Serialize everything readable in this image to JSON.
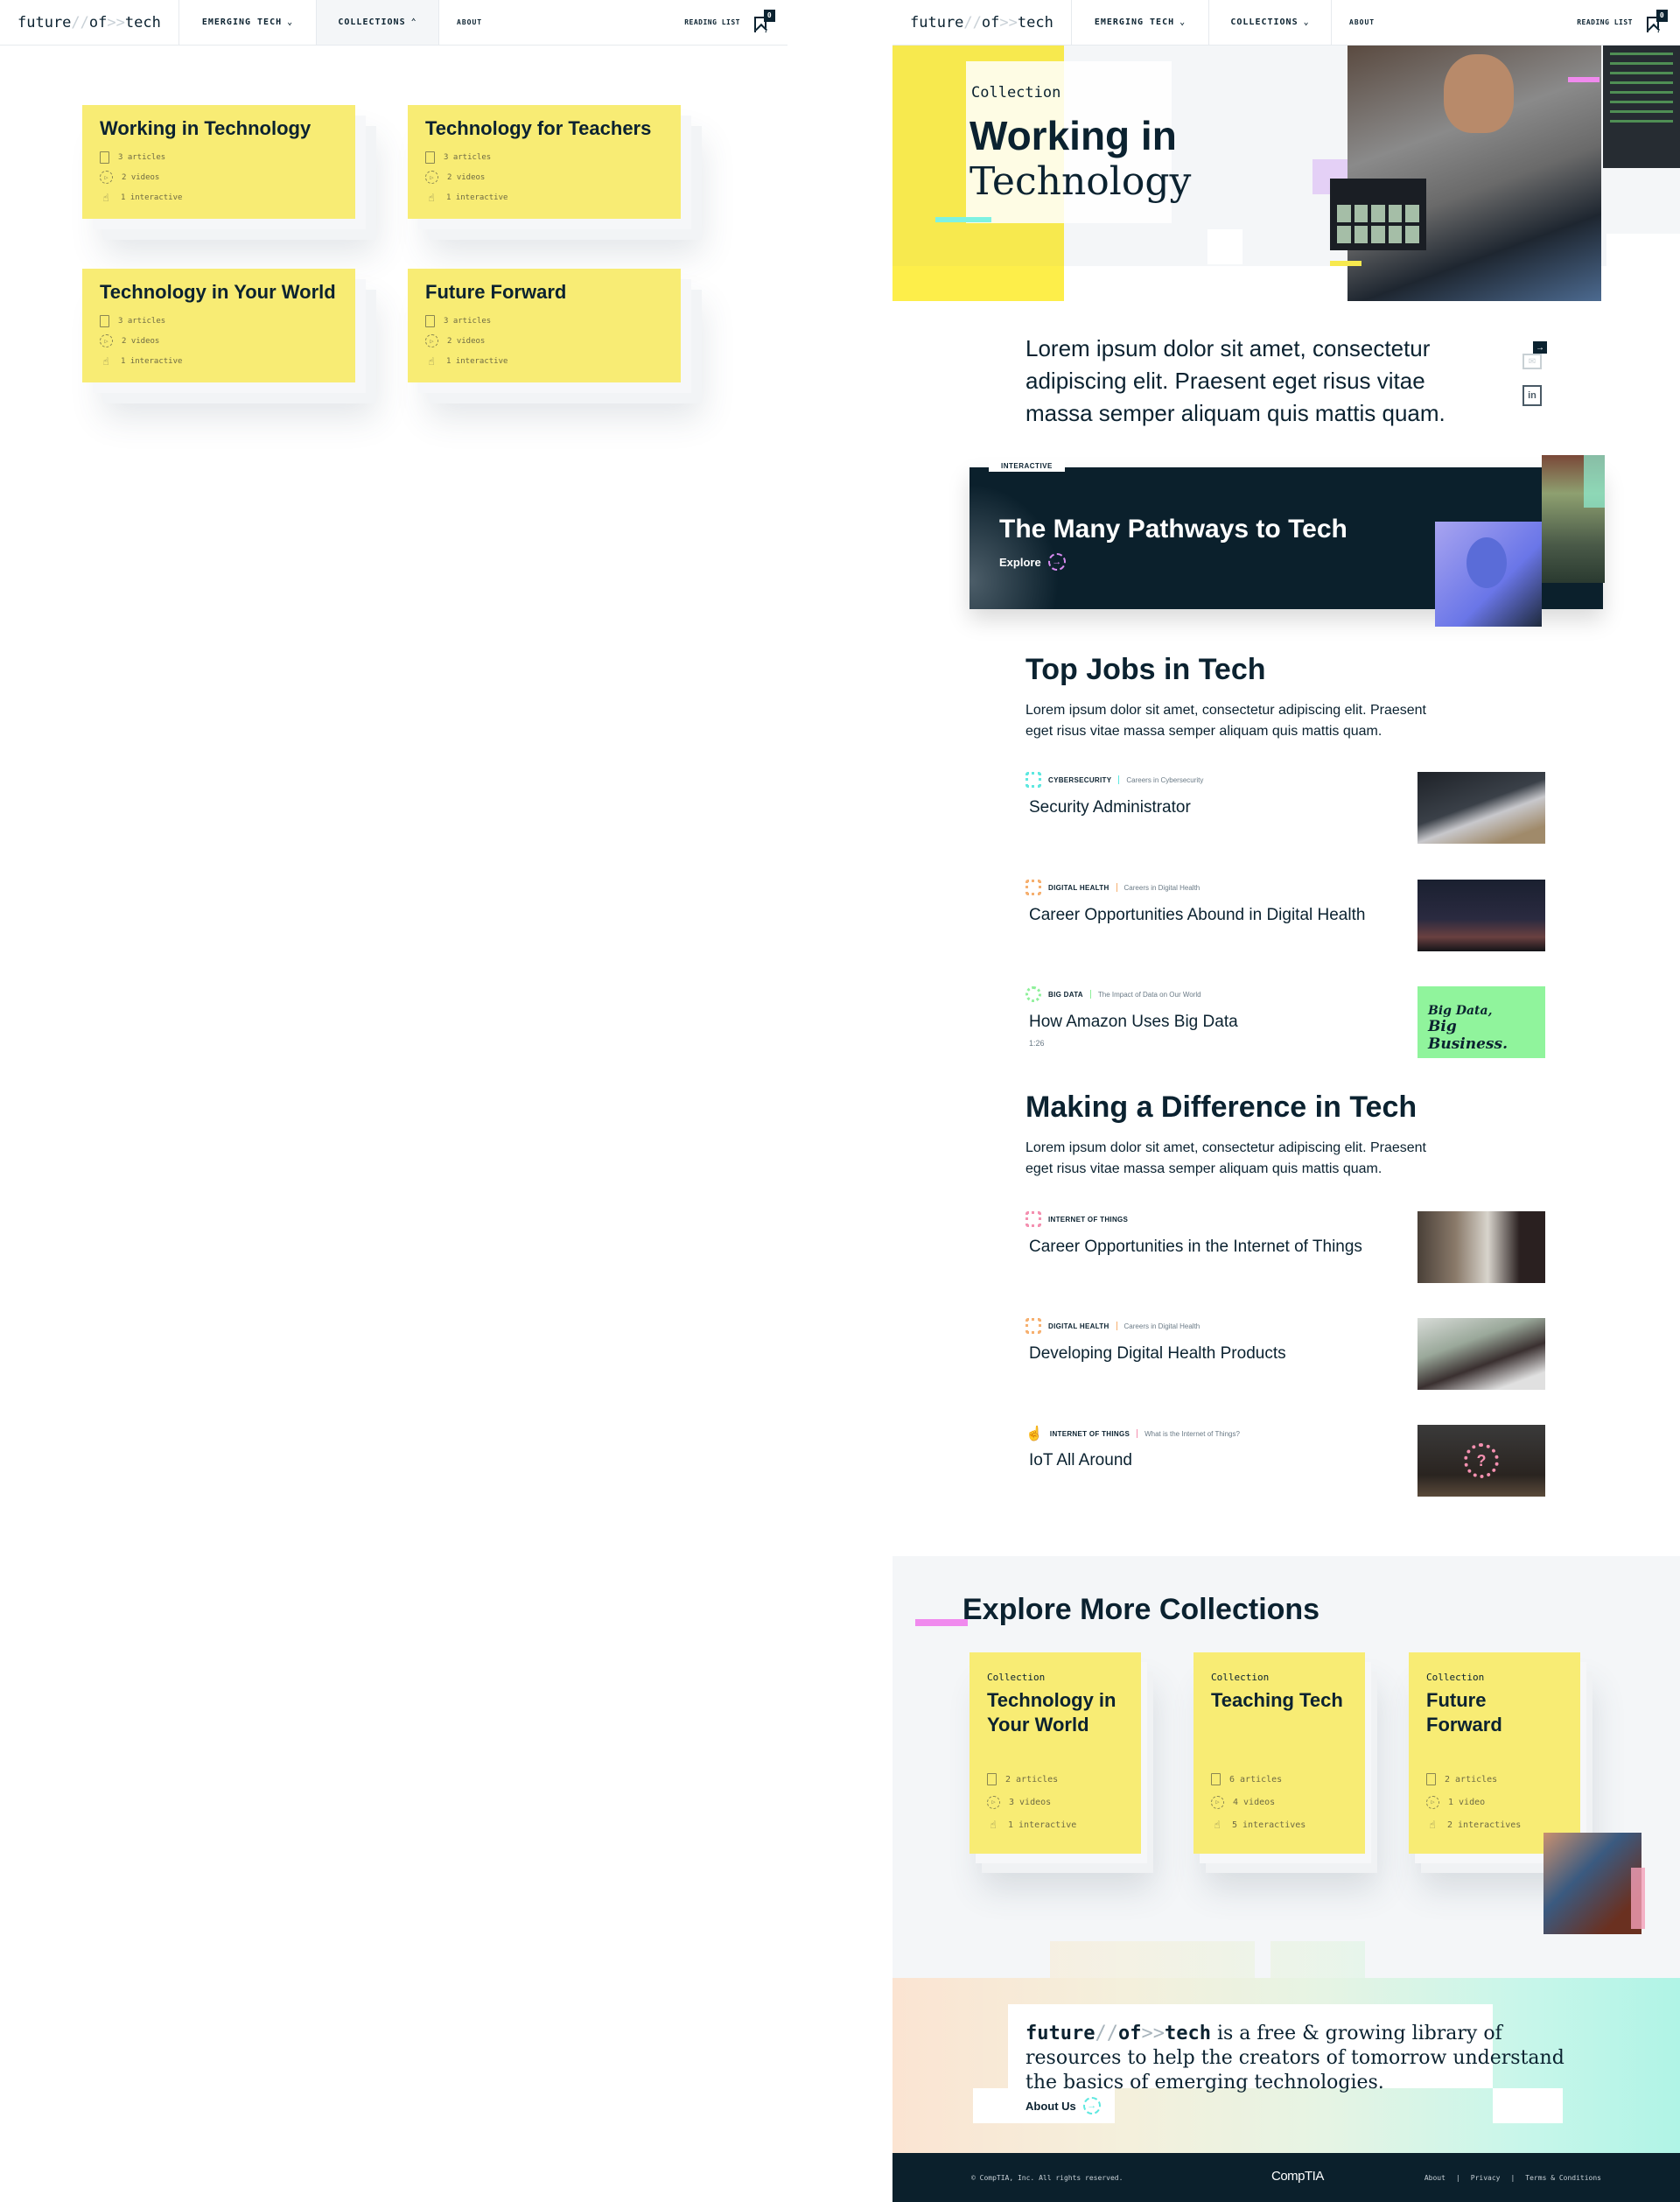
{
  "nav": {
    "logo": {
      "part1": "future",
      "sep1": "//",
      "part2": "of",
      "sep2": ">>",
      "part3": "tech"
    },
    "items": [
      {
        "label": "EMERGING TECH",
        "chevron": "chevron-down"
      },
      {
        "label": "COLLECTIONS",
        "chevron_open": "chevron-up",
        "chevron_closed": "chevron-down"
      },
      {
        "label": "ABOUT"
      }
    ],
    "reading_list": {
      "label": "READING LIST",
      "count": "0"
    }
  },
  "dropdown": {
    "cards": [
      {
        "title": "Working in Technology",
        "articles": "3 articles",
        "videos": "2 videos",
        "interactive": "1 interactive"
      },
      {
        "title": "Technology for Teachers",
        "articles": "3 articles",
        "videos": "2 videos",
        "interactive": "1 interactive"
      },
      {
        "title": "Technology in Your World",
        "articles": "3 articles",
        "videos": "2 videos",
        "interactive": "1 interactive"
      },
      {
        "title": "Future Forward",
        "articles": "3 articles",
        "videos": "2 videos",
        "interactive": "1 interactive"
      }
    ]
  },
  "hero": {
    "label": "Collection",
    "title_line1": "Working in",
    "title_line2": "Technology"
  },
  "intro": "Lorem ipsum dolor sit amet, consectetur adipiscing elit. Praesent eget risus vitae massa semper aliquam quis mattis quam.",
  "share": {
    "arrow": "→",
    "email_icon": "✉",
    "linkedin_icon": "in"
  },
  "promo": {
    "tag": "INTERACTIVE",
    "title": "The Many Pathways to Tech",
    "cta": "Explore",
    "arrow": "→"
  },
  "sections": [
    {
      "title": "Top Jobs in Tech",
      "description": "Lorem ipsum dolor sit amet, consectetur adipiscing elit. Praesent eget risus vitae massa semper aliquam quis mattis quam.",
      "items": [
        {
          "category": "CYBERSECURITY",
          "subcategory": "Careers in Cybersecurity",
          "title": "Security Administrator",
          "color": "#5ee8e0",
          "icon": "chip-icon",
          "duration": ""
        },
        {
          "category": "DIGITAL HEALTH",
          "subcategory": "Careers in Digital Health",
          "title": "Career Opportunities Abound in Digital Health",
          "color": "#f6b070",
          "icon": "chip-icon",
          "duration": ""
        },
        {
          "category": "BIG DATA",
          "subcategory": "The Impact of Data on Our World",
          "title": "How Amazon Uses Big Data",
          "color": "#8ef09a",
          "icon": "play-icon",
          "duration": "1:26",
          "thumb_text1": "Big Data,",
          "thumb_text2": "Big Business."
        }
      ]
    },
    {
      "title": "Making a Difference in Tech",
      "description": "Lorem ipsum dolor sit amet, consectetur adipiscing elit. Praesent eget risus vitae massa semper aliquam quis mattis quam.",
      "items": [
        {
          "category": "INTERNET OF THINGS",
          "subcategory": "",
          "title": "Career Opportunities in the Internet of Things",
          "color": "#f490b0",
          "icon": "chip-icon",
          "duration": ""
        },
        {
          "category": "DIGITAL HEALTH",
          "subcategory": "Careers in Digital Health",
          "title": "Developing Digital Health Products",
          "color": "#f6b070",
          "icon": "chip-icon",
          "duration": ""
        },
        {
          "category": "INTERNET OF THINGS",
          "subcategory": "What is the Internet of Things?",
          "title": "IoT All Around",
          "color": "#f490b0",
          "icon": "hand-icon",
          "duration": ""
        }
      ]
    }
  ],
  "explore": {
    "title": "Explore More Collections",
    "cards": [
      {
        "label": "Collection",
        "title": "Technology in Your World",
        "articles": "2 articles",
        "videos": "3 videos",
        "interactive": "1 interactive"
      },
      {
        "label": "Collection",
        "title": "Teaching Tech",
        "articles": "6 articles",
        "videos": "4 videos",
        "interactive": "5 interactives"
      },
      {
        "label": "Collection",
        "title": "Future Forward",
        "articles": "2 articles",
        "videos": "1 video",
        "interactive": "2 interactives"
      }
    ]
  },
  "about": {
    "brand": {
      "part1": "future",
      "sep1": "//",
      "part2": "of",
      "sep2": ">>",
      "part3": "tech"
    },
    "text": " is a free & growing library of resources to help the creators of tomorrow understand the basics of emerging technologies.",
    "cta": "About Us",
    "arrow": "→"
  },
  "footer": {
    "copyright": "© CompTIA, Inc. All rights reserved.",
    "brand": "CompTIA",
    "links": [
      "About",
      "|",
      "Privacy",
      "|",
      "Terms & Conditions"
    ]
  }
}
